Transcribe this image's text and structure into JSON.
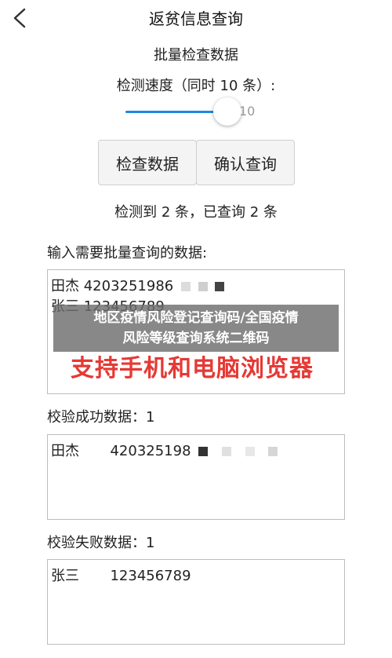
{
  "header": {
    "title": "返贫信息查询",
    "back_icon": "chevron-left-icon"
  },
  "subtitle": "批量检查数据",
  "speed": {
    "label": "检测速度（同时 10 条）:",
    "value": "10"
  },
  "buttons": {
    "check": "检查数据",
    "confirm": "确认查询"
  },
  "status": "检测到 2 条，已查询 2 条",
  "input_section": {
    "label": "输入需要批量查询的数据:",
    "lines": [
      "田杰 4203251986",
      "张三 123456789"
    ]
  },
  "success_section": {
    "label": "校验成功数据：1",
    "name": "田杰",
    "id": "420325198"
  },
  "fail_section": {
    "label": "校验失败数据：1",
    "name": "张三",
    "id": "123456789"
  },
  "overlay": {
    "line1": "地区疫情风险登记查询码/全国疫情",
    "line2": "风险等级查询系统二维码"
  },
  "watermark": "支持手机和电脑浏览器"
}
